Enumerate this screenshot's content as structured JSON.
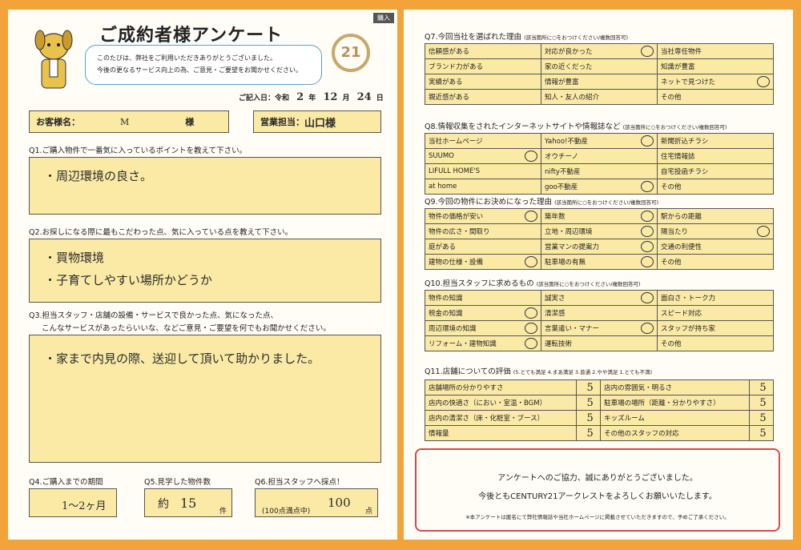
{
  "left": {
    "tag": "購入",
    "title": "ご成約者様アンケート",
    "intro_line1": "このたびは、弊社をご利用いただきありがとうございました。",
    "intro_line2": "今後の更なるサービス向上の為、ご意見・ご要望をお聞かせください。",
    "logo": "21",
    "date_label": "ご記入日：令和",
    "date_year": "2",
    "date_year_unit": "年",
    "date_month": "12",
    "date_month_unit": "月",
    "date_day": "24",
    "date_day_unit": "日",
    "customer_label": "お客様名：",
    "customer_name": "M",
    "customer_suffix": "様",
    "staff_label": "営業担当：",
    "staff_name": "山口様",
    "q1": "Q1.ご購入物件で一番気に入っているポイントを教えて下さい。",
    "a1": "・周辺環境の良さ。",
    "q2": "Q2.お探しになる際に最もこだわった点、気に入っている点を教えて下さい。",
    "a2_line1": "・買物環境",
    "a2_line2": "・子育てしやすい場所かどうか",
    "q3_line1": "Q3.担当スタッフ・店舗の設備・サービスで良かった点、気になった点、",
    "q3_line2": "こんなサービスがあったらいいな、などご意見・ご要望を何でもお聞かせください。",
    "a3": "・家まで内見の際、送迎して頂いて助かりました。",
    "q4": "Q4.ご購入までの期間",
    "a4": "1〜2ヶ月",
    "q5": "Q5.見学した物件数",
    "a5_prefix": "約",
    "a5": "15",
    "a5_unit": "件",
    "q6": "Q6.担当スタッフへ採点！",
    "a6_note": "(100点満点中)",
    "a6": "100",
    "a6_unit": "点"
  },
  "right": {
    "q7": {
      "title": "Q7.今回当社を選ばれた理由",
      "note": "(該当箇所に○をおつけください/複数回答可)",
      "rows": [
        [
          "信頼感がある",
          "対応が良かった",
          "当社専任物件"
        ],
        [
          "ブランド力がある",
          "家の近くだった",
          "知識が豊富"
        ],
        [
          "実績がある",
          "情報が豊富",
          "ネットで見つけた"
        ],
        [
          "親近感がある",
          "知人・友人の紹介",
          "その他"
        ]
      ],
      "circled": [
        [
          0,
          1
        ],
        [
          2,
          2
        ]
      ]
    },
    "q8": {
      "title": "Q8.情報収集をされたインターネットサイトや情報誌など",
      "note": "(該当箇所に○をおつけください/複数回答可)",
      "rows": [
        [
          "当社ホームページ",
          "Yahoo!不動産",
          "新聞折込チラシ"
        ],
        [
          "SUUMO",
          "オウチーノ",
          "住宅情報誌"
        ],
        [
          "LIFULL HOME'S",
          "nifty不動産",
          "自宅投函チラシ"
        ],
        [
          "at home",
          "goo不動産",
          "その他"
        ]
      ],
      "circled": [
        [
          0,
          1
        ],
        [
          1,
          0
        ],
        [
          3,
          1
        ]
      ]
    },
    "q9": {
      "title": "Q9.今回の物件にお決めになった理由",
      "note": "(該当箇所に○をおつけください/複数回答可)",
      "rows": [
        [
          "物件の価格が安い",
          "築年数",
          "駅からの距離"
        ],
        [
          "物件の広さ・間取り",
          "立地・周辺環境",
          "陽当たり"
        ],
        [
          "庭がある",
          "営業マンの提案力",
          "交通の利便性"
        ],
        [
          "建物の仕様・設備",
          "駐車場の有無",
          "その他"
        ]
      ],
      "circled": [
        [
          0,
          0
        ],
        [
          0,
          1
        ],
        [
          1,
          1
        ],
        [
          1,
          2
        ],
        [
          2,
          1
        ],
        [
          3,
          0
        ],
        [
          3,
          1
        ]
      ]
    },
    "q10": {
      "title": "Q10.担当スタッフに求めるもの",
      "note": "(該当箇所に○をおつけください/複数回答可)",
      "rows": [
        [
          "物件の知識",
          "誠実さ",
          "面白さ・トーク力"
        ],
        [
          "税金の知識",
          "清潔感",
          "スピード対応"
        ],
        [
          "周辺環境の知識",
          "言葉遣い・マナー",
          "スタッフが持ち家"
        ],
        [
          "リフォーム・建物知識",
          "運転技術",
          "その他"
        ]
      ],
      "circled": [
        [
          0,
          1
        ],
        [
          1,
          0
        ],
        [
          2,
          0
        ],
        [
          2,
          1
        ],
        [
          3,
          0
        ]
      ]
    },
    "q11": {
      "title": "Q11.店舗についての評価",
      "scale": "(5.とても満足 4.まあ満足 3.普通 2.やや満足 1.とても不満)",
      "rows": [
        [
          "店舗場所の分かりやすさ",
          "5",
          "店内の雰囲気・明るさ",
          "5"
        ],
        [
          "店内の快適さ（におい・室温・BGM）",
          "5",
          "駐車場の場所（距離・分かりやすさ）",
          "5"
        ],
        [
          "店内の清潔さ（床・化粧室・ブース）",
          "5",
          "キッズルーム",
          "5"
        ],
        [
          "情報量",
          "5",
          "その他のスタッフの対応",
          "5"
        ]
      ]
    },
    "thanks_line1": "アンケートへのご協力、誠にありがとうございました。",
    "thanks_line2": "今後ともCENTURY21アークレストをよろしくお願いいたします。",
    "thanks_note": "※本アンケートは匿名にて弊社情報誌や当社ホームページに掲載させていただきますので、予めご了承ください。"
  }
}
